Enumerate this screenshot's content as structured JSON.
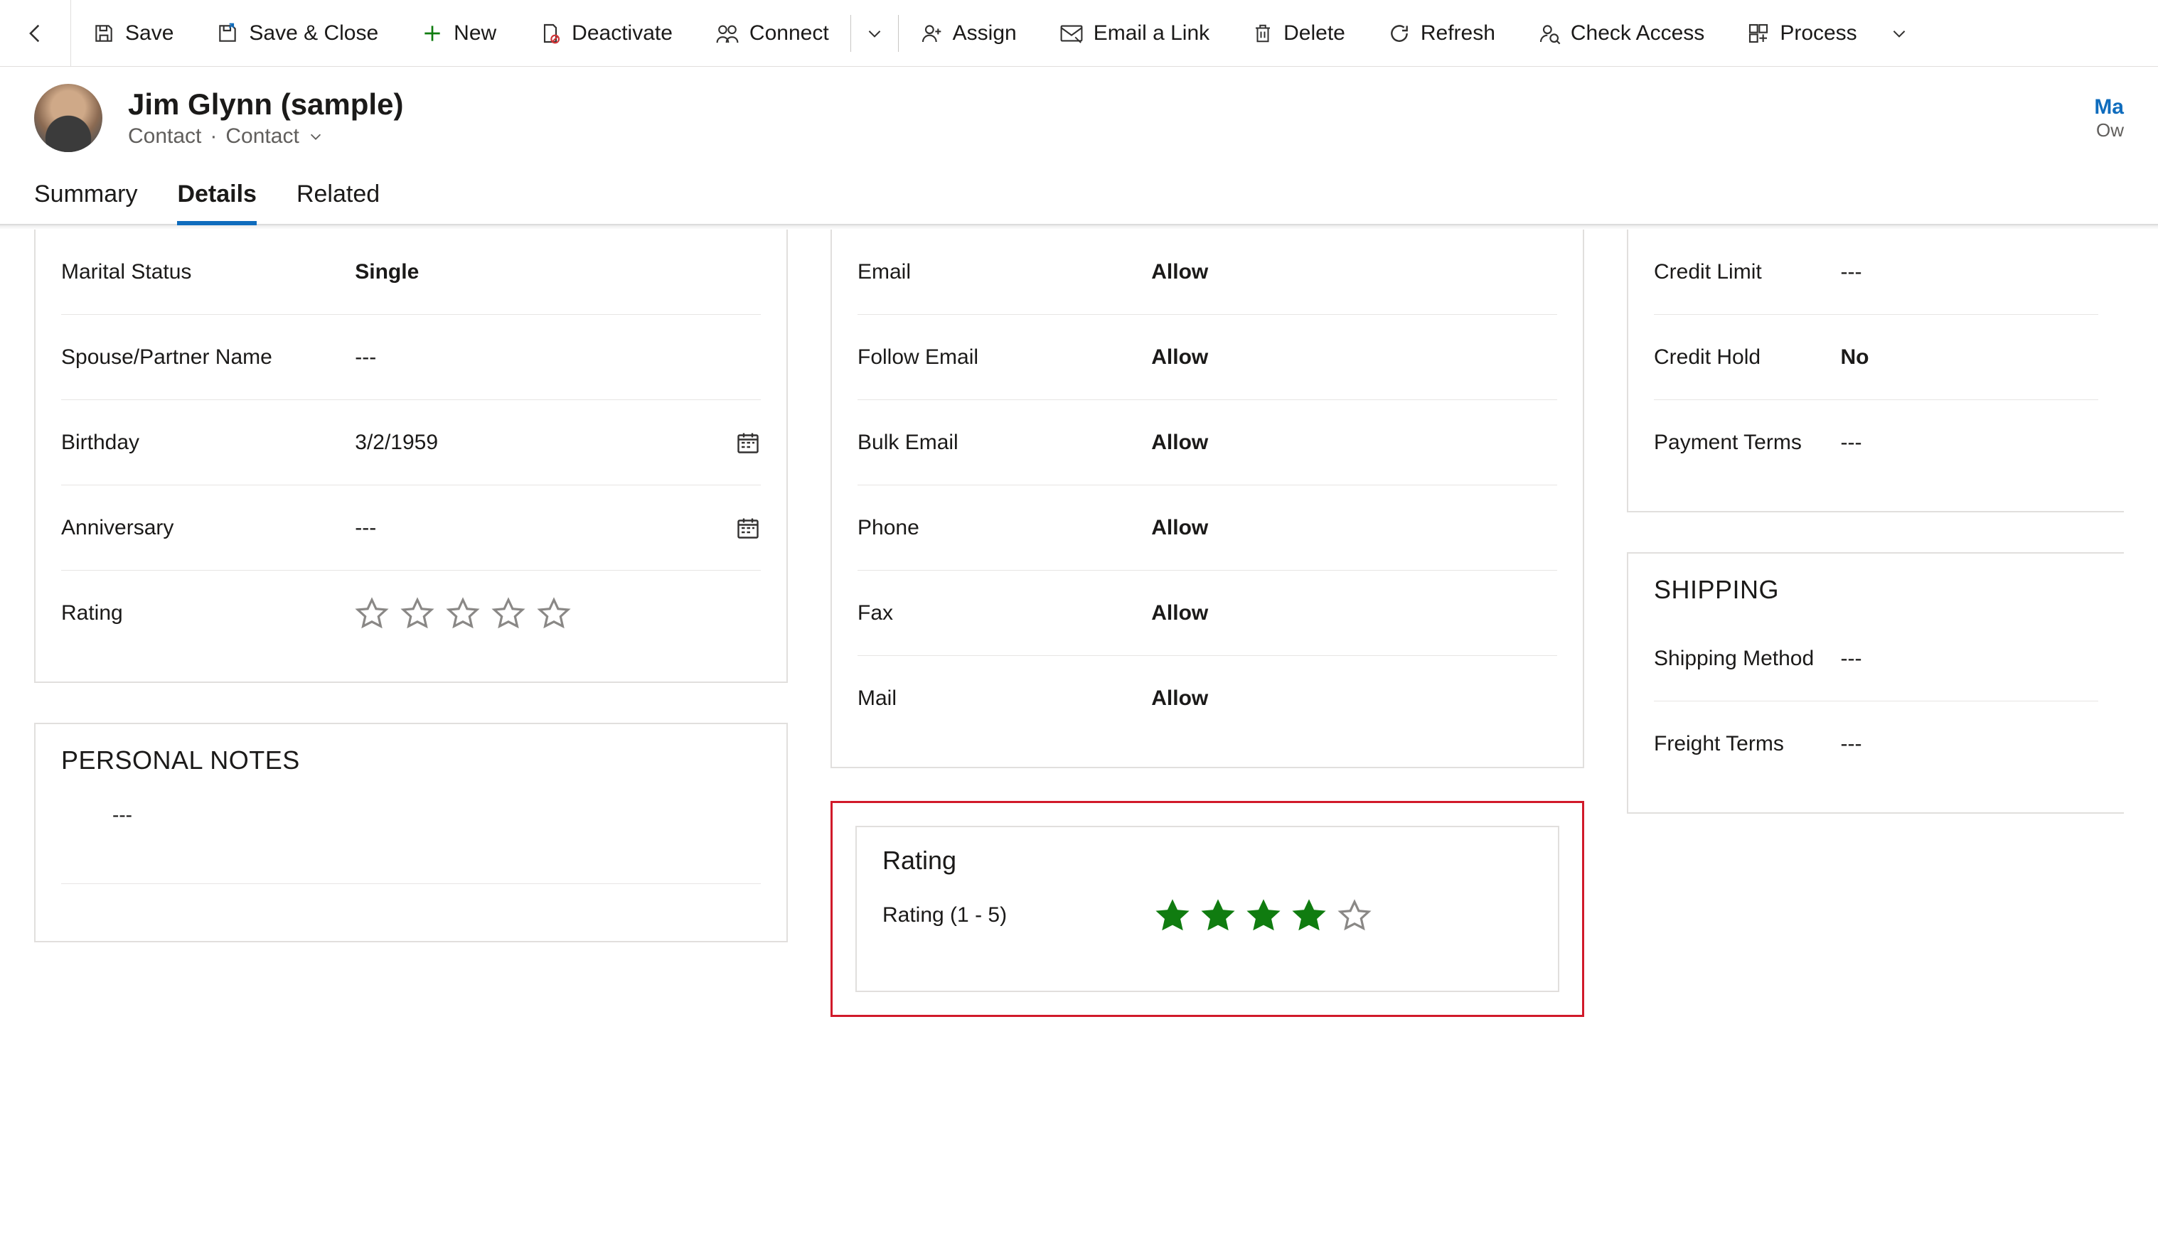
{
  "commands": {
    "save": "Save",
    "save_close": "Save & Close",
    "new": "New",
    "deactivate": "Deactivate",
    "connect": "Connect",
    "assign": "Assign",
    "email_link": "Email a Link",
    "delete": "Delete",
    "refresh": "Refresh",
    "check_access": "Check Access",
    "process": "Process"
  },
  "record": {
    "title": "Jim Glynn (sample)",
    "entity": "Contact",
    "form": "Contact",
    "owner_link": "Ma",
    "owner_label": "Ow"
  },
  "tabs": {
    "summary": "Summary",
    "details": "Details",
    "related": "Related",
    "active": "details"
  },
  "personal": {
    "marital_status_lbl": "Marital Status",
    "marital_status_val": "Single",
    "spouse_lbl": "Spouse/Partner Name",
    "spouse_val": "---",
    "birthday_lbl": "Birthday",
    "birthday_val": "3/2/1959",
    "anniversary_lbl": "Anniversary",
    "anniversary_val": "---",
    "rating_lbl": "Rating",
    "rating_val": 0
  },
  "personal_notes": {
    "title": "PERSONAL NOTES",
    "value": "---"
  },
  "contact_methods": {
    "email_lbl": "Email",
    "email_val": "Allow",
    "follow_email_lbl": "Follow Email",
    "follow_email_val": "Allow",
    "bulk_email_lbl": "Bulk Email",
    "bulk_email_val": "Allow",
    "phone_lbl": "Phone",
    "phone_val": "Allow",
    "fax_lbl": "Fax",
    "fax_val": "Allow",
    "mail_lbl": "Mail",
    "mail_val": "Allow"
  },
  "rating_card": {
    "title": "Rating",
    "field_lbl": "Rating (1 - 5)",
    "value": 4,
    "max": 5
  },
  "billing": {
    "credit_limit_lbl": "Credit Limit",
    "credit_limit_val": "---",
    "credit_hold_lbl": "Credit Hold",
    "credit_hold_val": "No",
    "payment_terms_lbl": "Payment Terms",
    "payment_terms_val": "---"
  },
  "shipping": {
    "title": "SHIPPING",
    "shipping_method_lbl": "Shipping Method",
    "shipping_method_val": "---",
    "freight_terms_lbl": "Freight Terms",
    "freight_terms_val": "---"
  },
  "colors": {
    "accent": "#0f6cbd",
    "star_filled": "#107c10",
    "highlight_border": "#d11a2a"
  }
}
